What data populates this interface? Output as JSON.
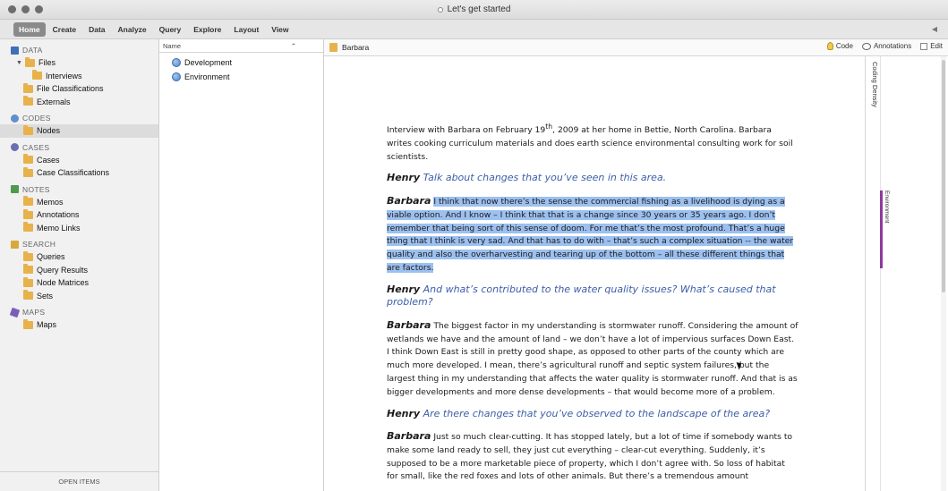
{
  "window": {
    "title": "Let's get started"
  },
  "ribbon": {
    "tabs": [
      "Home",
      "Create",
      "Data",
      "Analyze",
      "Query",
      "Explore",
      "Layout",
      "View"
    ]
  },
  "nav": {
    "data": {
      "label": "DATA",
      "files": "Files",
      "interviews": "Interviews",
      "file_classifications": "File Classifications",
      "externals": "Externals"
    },
    "codes": {
      "label": "CODES",
      "nodes": "Nodes"
    },
    "cases": {
      "label": "CASES",
      "cases": "Cases",
      "case_classifications": "Case Classifications"
    },
    "notes": {
      "label": "NOTES",
      "memos": "Memos",
      "annotations": "Annotations",
      "memo_links": "Memo Links"
    },
    "search": {
      "label": "SEARCH",
      "queries": "Queries",
      "query_results": "Query Results",
      "node_matrices": "Node Matrices",
      "sets": "Sets"
    },
    "maps": {
      "label": "MAPS",
      "maps": "Maps"
    },
    "open_items": "OPEN ITEMS"
  },
  "list": {
    "column_header": "Name",
    "rows": [
      "Development",
      "Environment"
    ]
  },
  "detail": {
    "document_name": "Barbara",
    "code_label": "Code",
    "annotations_label": "Annotations",
    "edit_label": "Edit"
  },
  "document": {
    "intro_before": "Interview with Barbara on February 19",
    "intro_sup": "th",
    "intro_after": ", 2009 at her home in Bettie, North Carolina. Barbara writes cooking curriculum materials and does earth science environmental consulting work for soil scientists.",
    "interviewer": "Henry",
    "respondent": "Barbara",
    "q1": "Talk about changes that you’ve seen in this area.",
    "a1": "I think that now there’s the sense the commercial fishing as a livelihood is dying as a viable option. And I know – I think that that is a change since 30 years or 35 years ago. I don’t remember that being sort of this sense of doom. For me that’s the most profound. That’s a huge thing that I think is very sad. And that has to do with – that’s such a complex situation -- the water quality and also the overharvesting and tearing up of the bottom – all these different things that are factors.",
    "q2": "And what’s contributed to the water quality issues? What’s caused that problem?",
    "a2": "The biggest factor in my understanding is stormwater runoff. Considering the amount of wetlands we have and the amount of land – we don’t have a lot of impervious surfaces Down East. I think Down East is still in pretty good shape, as opposed to other parts of the county which are much more developed. I mean, there’s agricultural runoff and septic system failures, but the largest thing in my understanding that affects the water quality is stormwater runoff. And that is as bigger developments and more dense developments – that would become more of a problem.",
    "q3": "Are there changes that you’ve observed to the landscape of the area?",
    "a3": "Just so much clear-cutting. It has stopped lately, but a lot of time if somebody wants to make some land ready to sell, they just cut everything – clear-cut everything. Suddenly, it’s supposed to be a more marketable piece of property, which I don’t agree with. So loss of habitat for small, like the red foxes and lots of other animals. But there’s a tremendous amount"
  },
  "coding_stripes": {
    "density_label": "Coding Density",
    "environment_label": "Environment",
    "environment_color": "#8e3a9e"
  }
}
